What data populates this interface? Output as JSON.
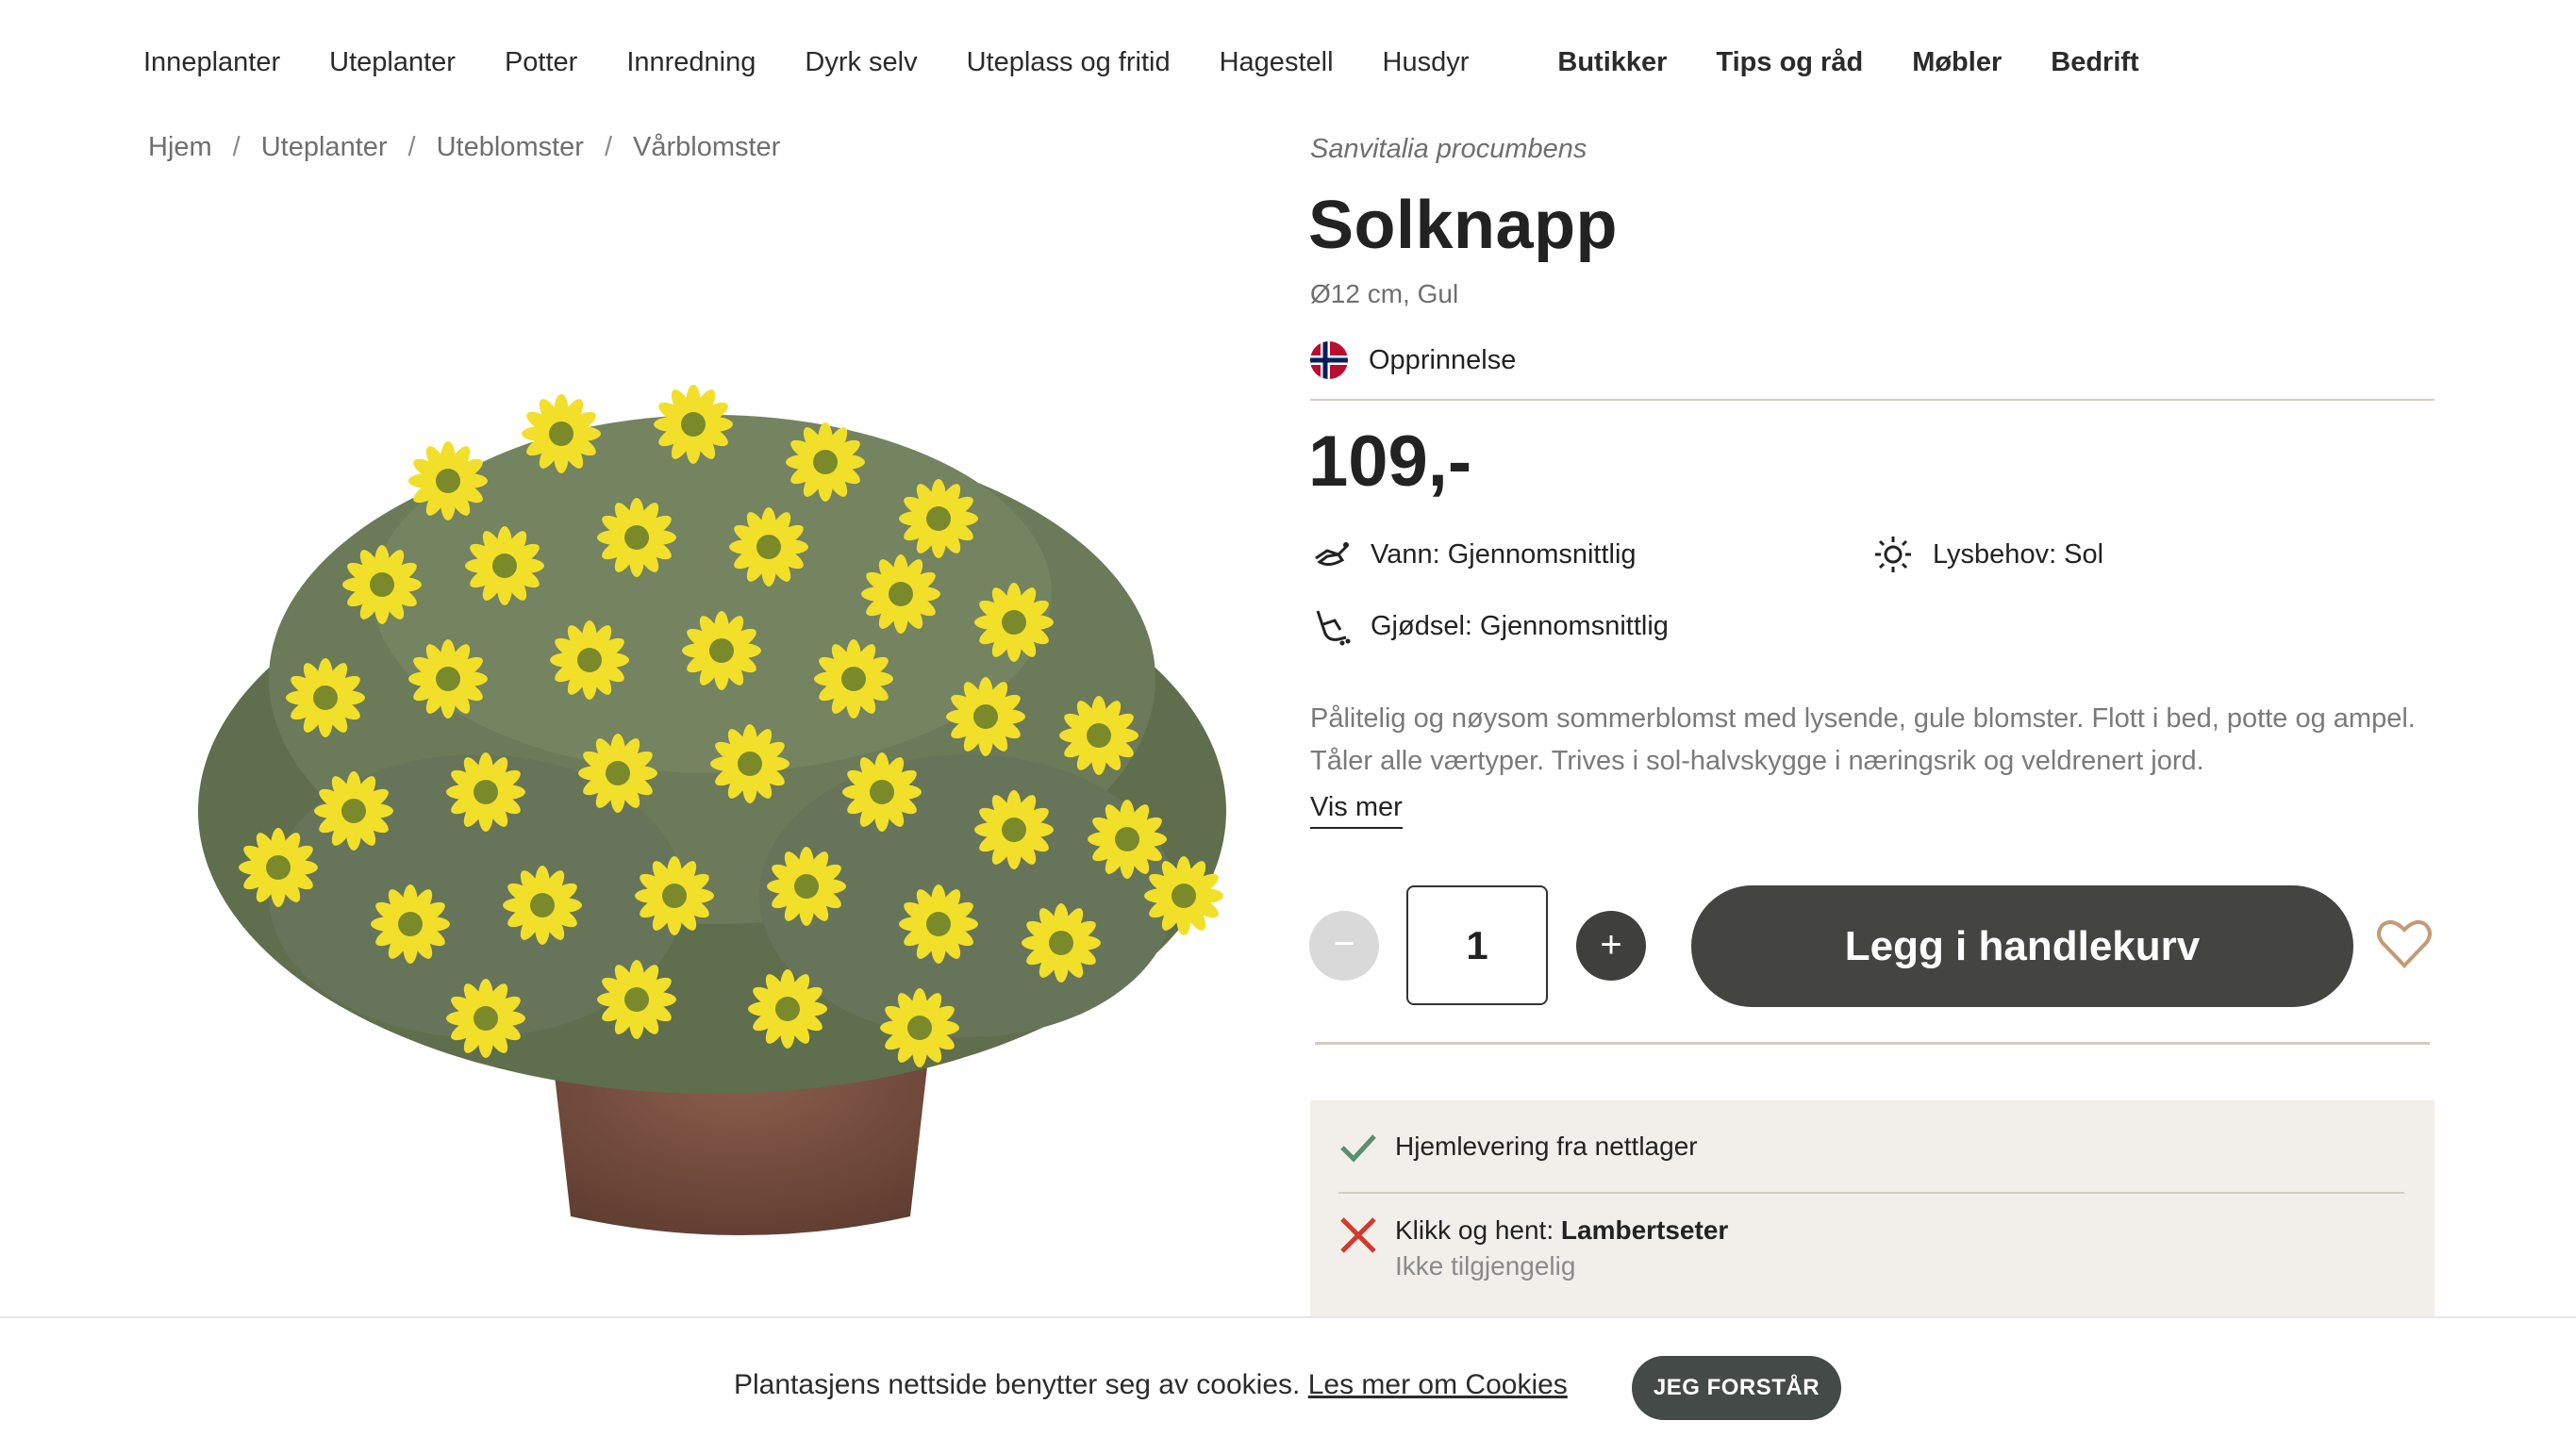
{
  "nav": {
    "items": [
      "Inneplanter",
      "Uteplanter",
      "Potter",
      "Innredning",
      "Dyrk selv",
      "Uteplass og fritid",
      "Hagestell",
      "Husdyr"
    ],
    "secondary": [
      "Butikker",
      "Tips og råd",
      "Møbler",
      "Bedrift"
    ]
  },
  "breadcrumb": [
    "Hjem",
    "Uteplanter",
    "Uteblomster",
    "Vårblomster"
  ],
  "breadcrumb_separator": "/",
  "product": {
    "latin_name": "Sanvitalia procumbens",
    "name": "Solknapp",
    "variant": "Ø12 cm, Gul",
    "origin_label": "Opprinnelse",
    "price": "109,-",
    "care": {
      "water": "Vann: Gjennomsnittlig",
      "light": "Lysbehov: Sol",
      "fertilizer": "Gjødsel: Gjennomsnittlig"
    },
    "description": "Pålitelig og nøysom sommerblomst med lysende, gule blomster. Flott i bed, potte og ampel. Tåler alle værtyper. Trives i sol-halvskygge i næringsrik og veldrenert jord.",
    "show_more": "Vis mer",
    "image_icon": "flower-pot-image"
  },
  "purchase": {
    "minus": "−",
    "quantity": "1",
    "plus": "+",
    "add_to_cart": "Legg i handlekurv"
  },
  "delivery": {
    "home_delivery": "Hjemlevering fra nettlager",
    "click_collect_prefix": "Klikk og hent:",
    "click_collect_store": "Lambertseter",
    "click_collect_status": "Ikke tilgjengelig"
  },
  "cookie": {
    "text": "Plantasjens nettside benytter seg av cookies.",
    "link": "Les mer om Cookies",
    "accept": "JEG FORSTÅR"
  },
  "colors": {
    "dark_button": "#444441",
    "divider": "#d2cdbf",
    "delivery_bg": "#f2efea",
    "check_green": "#5a8f6e",
    "cross_red": "#d23a2e",
    "heart": "#c49a74",
    "flower_yellow": "#f2df2a",
    "leaf_green": "#6b7a58",
    "pot_brown": "#7a5142"
  }
}
